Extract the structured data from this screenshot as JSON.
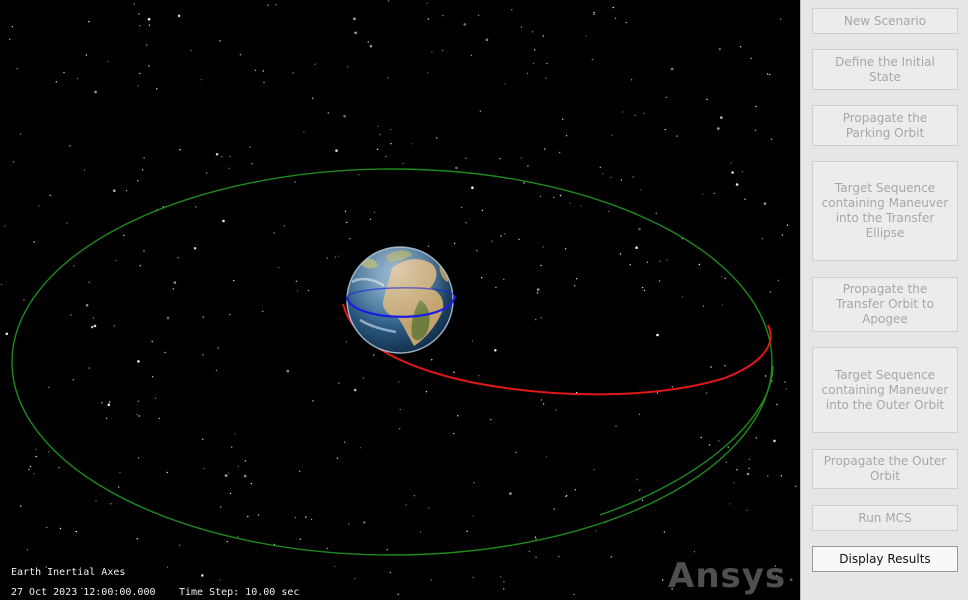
{
  "viewport": {
    "axes_label": "Earth Inertial Axes",
    "datetime": "27 Oct 2023 12:00:00.000",
    "time_step": "Time Step: 10.00 sec",
    "logo_text": "Ansys",
    "colors": {
      "outer_orbit": "#1e8a1e",
      "transfer_orbit": "#e01818",
      "parking_orbit": "#1c1ce0",
      "space": "#000000"
    }
  },
  "sidebar": {
    "buttons": [
      {
        "label": "New Scenario",
        "enabled": false
      },
      {
        "label": "Define the Initial State",
        "enabled": false
      },
      {
        "label": "Propagate the Parking Orbit",
        "enabled": false
      },
      {
        "label": "Target Sequence containing Maneuver into the Transfer Ellipse",
        "enabled": false
      },
      {
        "label": "Propagate the Transfer Orbit to Apogee",
        "enabled": false
      },
      {
        "label": "Target Sequence containing Maneuver into the Outer Orbit",
        "enabled": false
      },
      {
        "label": "Propagate the Outer Orbit",
        "enabled": false
      },
      {
        "label": "Run MCS",
        "enabled": false
      },
      {
        "label": "Display Results",
        "enabled": true
      }
    ]
  }
}
